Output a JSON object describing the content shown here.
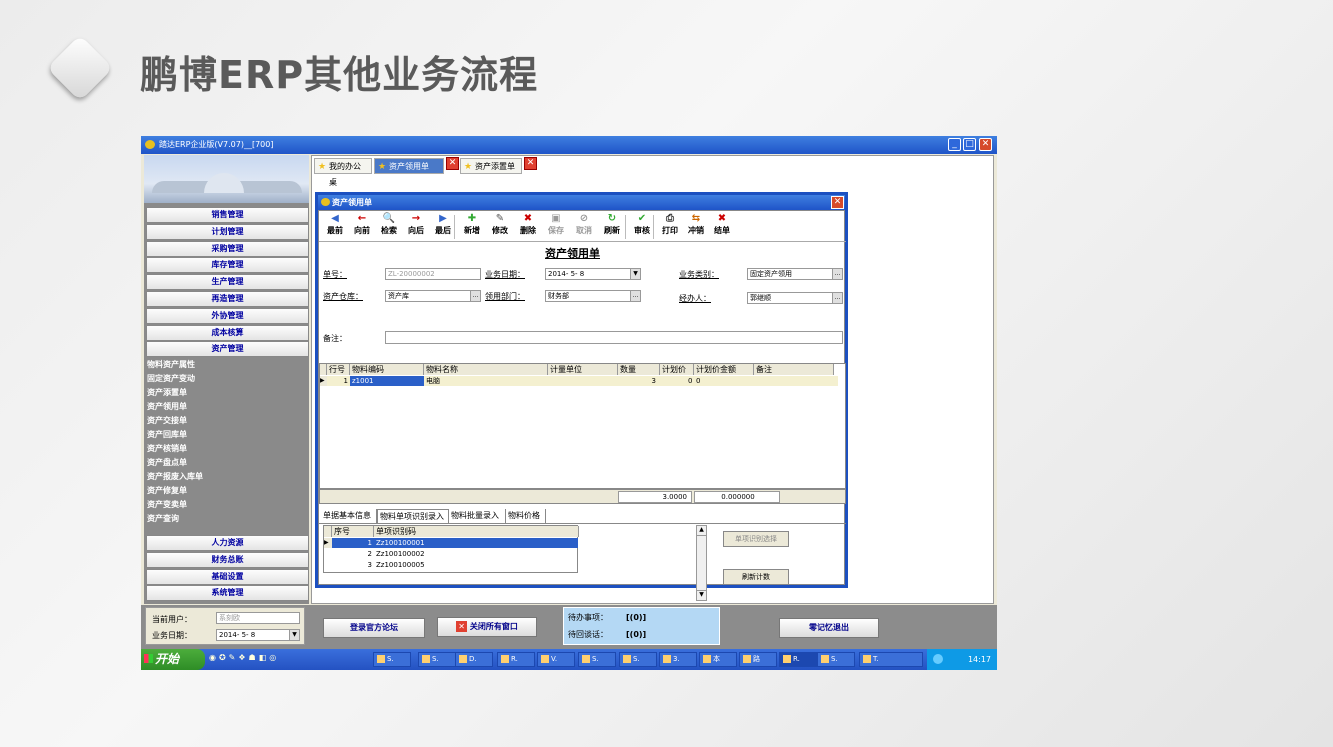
{
  "slide": {
    "title": "鹏博ERP其他业务流程"
  },
  "window": {
    "title": "踏达ERP企业版(V7.07)__[700]"
  },
  "sidebar": {
    "menu_top": [
      "销售管理",
      "计划管理",
      "采购管理",
      "库存管理",
      "生产管理",
      "再造管理",
      "外协管理",
      "成本核算",
      "资产管理"
    ],
    "sub_items": [
      "物料资产属性",
      "固定资产变动",
      "资产添置单",
      "资产领用单",
      "资产交接单",
      "资产回库单",
      "资产核销单",
      "资产盘点单",
      "资产报废入库单",
      "资产修复单",
      "资产变卖单",
      "资产查询"
    ],
    "menu_bottom": [
      "人力资源",
      "财务总账",
      "基础设置",
      "系统管理"
    ]
  },
  "tabs": [
    "我的办公桌",
    "资产领用单",
    "资产添置单"
  ],
  "dialog": {
    "title": "资产领用单",
    "toolbar": [
      "最前",
      "向前",
      "检索",
      "向后",
      "最后",
      "新增",
      "修改",
      "删除",
      "保存",
      "取消",
      "刷新",
      "审核",
      "打印",
      "冲销",
      "结单"
    ],
    "toolbar_icons": [
      "first-icon",
      "prev-icon",
      "search-icon",
      "next-icon",
      "last-icon",
      "add-icon",
      "edit-icon",
      "delete-icon",
      "save-icon",
      "cancel-icon",
      "refresh-icon",
      "approve-icon",
      "print-icon",
      "reverse-icon",
      "close-doc-icon"
    ],
    "form_title": "资产领用单",
    "fields": {
      "doc_no_label": "单号：",
      "doc_no": "ZL-20000002",
      "biz_date_label": "业务日期：",
      "biz_date": "2014- 5- 8",
      "biz_type_label": "业务类别：",
      "biz_type": "固定资产领用",
      "warehouse_label": "资产仓库：",
      "warehouse": "资产库",
      "dept_label": "领用部门：",
      "dept": "财务部",
      "handler_label": "经办人：",
      "handler": "郭继顺",
      "remark_label": "备注："
    },
    "grid": {
      "headers": [
        "行号",
        "物料编码",
        "物料名称",
        "计量单位",
        "数量",
        "计划价",
        "计划价金额",
        "备注"
      ],
      "rows": [
        {
          "row_no": "1",
          "code": "z1001",
          "name": "电脑",
          "unit": "",
          "qty": "3",
          "price": "0",
          "amount": "0",
          "remark": ""
        }
      ],
      "total_qty": "3.0000",
      "total_amount": "0.000000"
    },
    "bottom_tabs": [
      "单据基本信息",
      "物料单项识别录入",
      "物料批量录入",
      "物料价格"
    ],
    "subgrid": {
      "headers": [
        "序号",
        "单项识别码"
      ],
      "rows": [
        {
          "no": "1",
          "code": "Zz100100001"
        },
        {
          "no": "2",
          "code": "Zz100100002"
        },
        {
          "no": "3",
          "code": "Zz100100005"
        }
      ]
    },
    "side_buttons": [
      "单项识别选择",
      "刷新计数"
    ]
  },
  "status": {
    "user_label": "当前用户：",
    "user": "系刻欧",
    "date_label": "业务日期：",
    "date": "2014- 5- 8",
    "forum_button": "登录官方论坛",
    "close_all_button": "关闭所有窗口",
    "pending_label": "待办事项：",
    "pending_value": "[(0)]",
    "reply_label": "待回谈话：",
    "reply_value": "[(0)]",
    "exit_button": "零记忆退出"
  },
  "taskbar": {
    "start": "开始",
    "items": [
      "S.",
      "S.",
      "D.",
      "R.",
      "V.",
      "S.",
      "S.",
      "3.",
      "本",
      "路",
      "R.",
      "S.",
      "T."
    ],
    "clock": "14:17"
  }
}
